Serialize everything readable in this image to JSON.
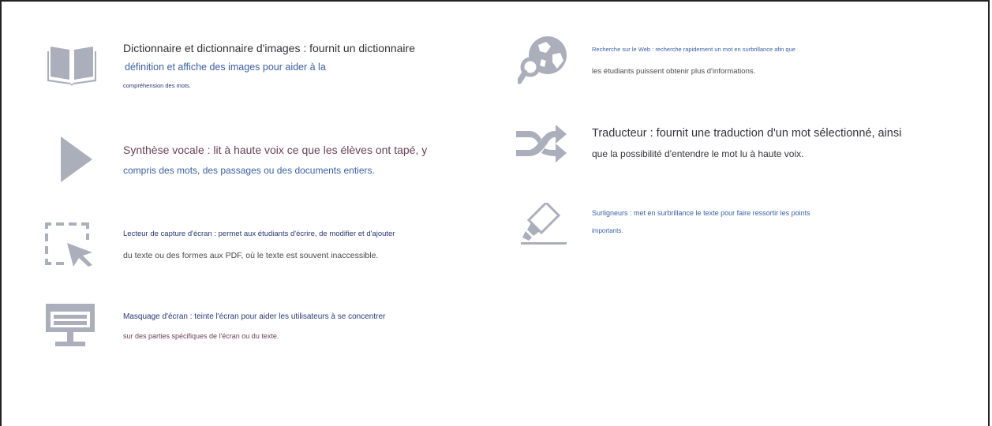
{
  "colors": {
    "icon": "#aaafbb",
    "text_dark": "#333338",
    "text_blue": "#3b5fa8",
    "text_navy": "#2a3677",
    "text_plum": "#6a3f55"
  },
  "features": {
    "dictionary": {
      "icon": "open-book-icon",
      "line1": "Dictionnaire et dictionnaire d'images : fournit un dictionnaire",
      "line2": "définition et affiche des images pour aider à la",
      "line3": "compréhension des mots."
    },
    "tts": {
      "icon": "play-icon",
      "line1": "Synthèse vocale : lit à haute voix ce que les élèves ont tapé, y",
      "line2": "compris des mots, des passages ou des documents entiers."
    },
    "screen_capture": {
      "icon": "selection-cursor-icon",
      "line1": "Lecteur de capture d'écran : permet aux étudiants d'écrire, de modifier et d'ajouter",
      "line2": "du texte ou des formes aux PDF, où le texte est souvent inaccessible."
    },
    "screen_mask": {
      "icon": "monitor-icon",
      "line1": "Masquage d'écran : teinte l'écran pour aider les utilisateurs à se concentrer",
      "line2": "sur des parties spécifiques de l'écran ou du texte."
    },
    "web_search": {
      "icon": "globe-search-icon",
      "line1": "Recherche sur le Web : recherche rapidement un mot en surbrillance afin que",
      "line2": "les étudiants puissent obtenir plus d'informations."
    },
    "translator": {
      "icon": "shuffle-arrows-icon",
      "line1": "Traducteur : fournit une traduction d'un mot sélectionné, ainsi",
      "line2": "que la possibilité d'entendre le mot lu à haute voix."
    },
    "highlighter": {
      "icon": "highlighter-icon",
      "line1": "Surligneurs : met en surbrillance le texte pour faire ressortir les points",
      "line2": "importants."
    }
  }
}
